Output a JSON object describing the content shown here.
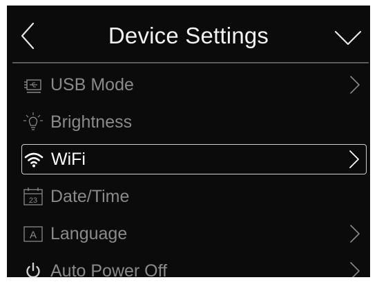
{
  "header": {
    "title": "Device Settings",
    "back_icon": "chevron-left-icon",
    "collapse_icon": "chevron-down-icon"
  },
  "menu": {
    "items": [
      {
        "label": "USB Mode",
        "icon": "usb-icon",
        "has_submenu": true,
        "selected": false
      },
      {
        "label": "Brightness",
        "icon": "brightness-icon",
        "has_submenu": false,
        "selected": false
      },
      {
        "label": "WiFi",
        "icon": "wifi-icon",
        "has_submenu": true,
        "selected": true
      },
      {
        "label": "Date/Time",
        "icon": "calendar-icon",
        "has_submenu": false,
        "selected": false
      },
      {
        "label": "Language",
        "icon": "language-icon",
        "has_submenu": true,
        "selected": false
      },
      {
        "label": "Auto Power Off",
        "icon": "power-icon",
        "has_submenu": true,
        "selected": false
      }
    ],
    "calendar_icon_text": "23",
    "language_icon_text": "A"
  },
  "colors": {
    "background": "#0b0b0b",
    "text_active": "#ffffff",
    "text_inactive": "#8a8a8a",
    "selection_border": "#d0d0d0"
  }
}
